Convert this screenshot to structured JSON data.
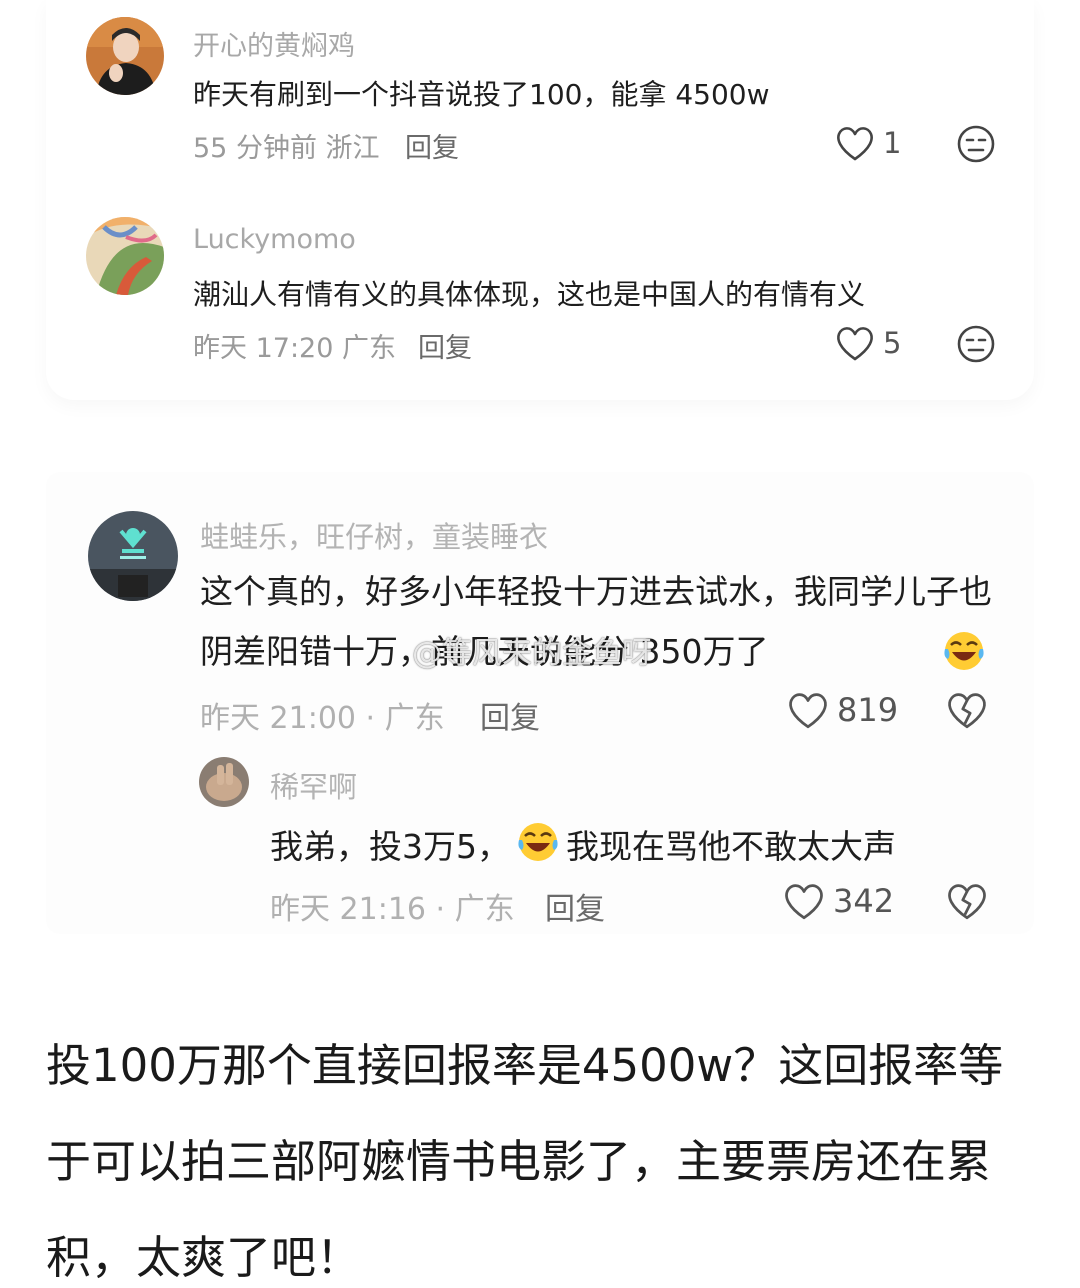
{
  "comments": [
    {
      "username": "开心的黄焖鸡",
      "text": "昨天有刷到一个抖音说投了100，能拿 4500w",
      "time_location": "55 分钟前 浙江",
      "reply_label": "回复",
      "likes": "1",
      "avatar_icon": "person-avatar-icon",
      "action_icon": "neutral-face-icon"
    },
    {
      "username": "Luckymomo",
      "text": "潮汕人有情有义的具体体现，这也是中国人的有情有义",
      "time_location": "昨天 17:20 广东",
      "reply_label": "回复",
      "likes": "5",
      "avatar_icon": "painting-avatar-icon",
      "action_icon": "neutral-face-icon"
    },
    {
      "username": "蛙蛙乐，旺仔树，童装睡衣",
      "text": "这个真的，好多小年轻投十万进去试水，我同学儿子也阴差阳错十万，前几天说能分 350万了",
      "time_location": "昨天 21:00 · 广东",
      "reply_label": "回复",
      "likes": "819",
      "avatar_icon": "store-logo-avatar-icon",
      "action_icon": "broken-heart-icon"
    },
    {
      "username": "稀罕啊",
      "text_before_emoji": "我弟，投3万5，",
      "text_after_emoji": "我现在骂他不敢太大声",
      "time_location": "昨天 21:16 · 广东",
      "reply_label": "回复",
      "likes": "342",
      "avatar_icon": "hand-avatar-icon",
      "action_icon": "broken-heart-icon"
    }
  ],
  "watermark": "@等风来的金鱼呀",
  "caption": "投100万那个直接回报率是4500w？这回报率等于可以拍三部阿嬷情书电影了，主要票房还在累积，太爽了吧！",
  "colors": {
    "username": "#a8a8a8",
    "meta": "#9a9a9a",
    "text": "#1e1e1e",
    "emoji_face": "#ffcc33"
  }
}
